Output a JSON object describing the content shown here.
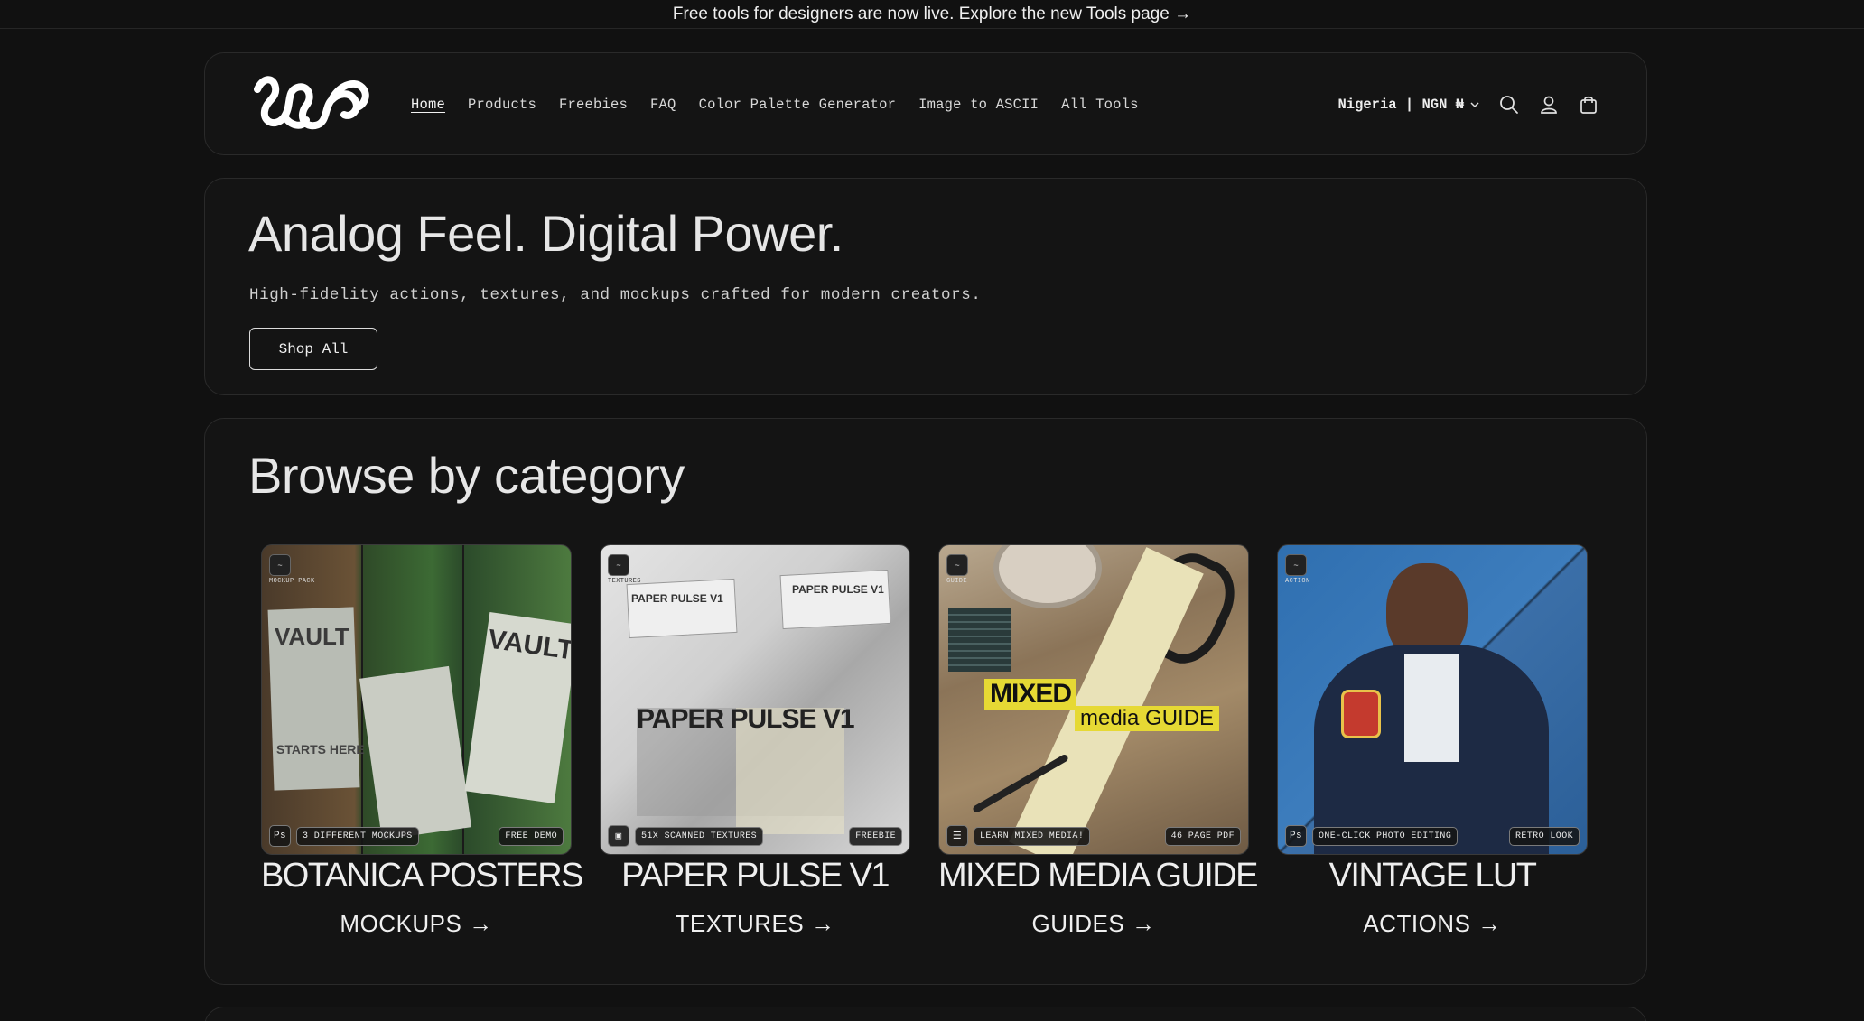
{
  "announcement": "Free tools for designers are now live. Explore the new Tools page →",
  "header": {
    "logo_icon": "brand-wave-logo",
    "nav": [
      {
        "label": "Home",
        "active": true
      },
      {
        "label": "Products"
      },
      {
        "label": "Freebies"
      },
      {
        "label": "FAQ"
      },
      {
        "label": "Color Palette Generator"
      },
      {
        "label": "Image to ASCII"
      },
      {
        "label": "All Tools"
      }
    ],
    "locale": "Nigeria | NGN ₦",
    "icons": [
      "chevron-down-icon",
      "search-icon",
      "account-icon",
      "cart-icon"
    ]
  },
  "hero": {
    "title": "Analog Feel. Digital Power.",
    "subtitle": "High-fidelity actions, textures, and mockups crafted for modern creators.",
    "cta": "Shop All"
  },
  "categories": {
    "heading": "Browse by category",
    "items": [
      {
        "product": "BOTANICA POSTERS",
        "link": "MOCKUPS →",
        "tag": "MOCKUP PACK",
        "badge_icon": "Ps",
        "chip_left": "3 DIFFERENT MOCKUPS",
        "chip_right": "FREE DEMO",
        "poster_text_1": "VAULT",
        "poster_text_2": "STARTS HERE",
        "accent": "#3e6b3a"
      },
      {
        "product": "PAPER PULSE V1",
        "link": "TEXTURES →",
        "tag": "TEXTURES",
        "badge_icon": "image-icon",
        "chip_left": "51X SCANNED TEXTURES",
        "chip_right": "FREEBIE",
        "poster_text_1": "PAPER PULSE V1",
        "accent": "#cfcfcf"
      },
      {
        "product": "MIXED MEDIA GUIDE",
        "link": "GUIDES →",
        "tag": "GUIDE",
        "badge_icon": "doc-icon",
        "chip_left": "LEARN MIXED MEDIA!",
        "chip_right": "46 PAGE PDF",
        "poster_text_1": "MIXED",
        "poster_text_2": "media GUIDE",
        "accent": "#8a7050"
      },
      {
        "product": "VINTAGE LUT",
        "link": "ACTIONS →",
        "tag": "ACTION",
        "badge_icon": "Ps",
        "chip_left": "ONE-CLICK PHOTO EDITING",
        "chip_right": "RETRO LOOK",
        "accent": "#3b6fa8"
      }
    ]
  }
}
